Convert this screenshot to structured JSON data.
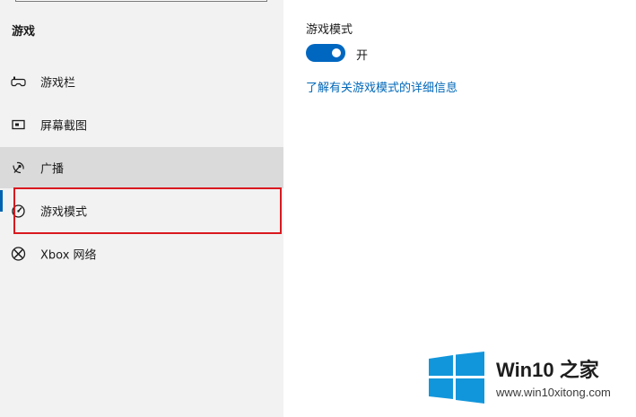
{
  "sidebar": {
    "section_title": "游戏",
    "items": [
      {
        "label": "游戏栏",
        "icon": "game-bar-icon"
      },
      {
        "label": "屏幕截图",
        "icon": "captures-icon"
      },
      {
        "label": "广播",
        "icon": "broadcast-icon"
      },
      {
        "label": "游戏模式",
        "icon": "game-mode-icon"
      },
      {
        "label": "Xbox 网络",
        "icon": "xbox-icon"
      }
    ],
    "active_index": 3,
    "hover_index": 2
  },
  "main": {
    "setting_title": "游戏模式",
    "toggle_state": "开",
    "toggle_on": true,
    "link_text": "了解有关游戏模式的详细信息"
  },
  "watermark": {
    "title": "Win10 之家",
    "url": "www.win10xitong.com"
  },
  "colors": {
    "accent": "#0067c0",
    "link": "#0067b8",
    "highlight": "#d9191f",
    "sidebar_bg": "#f2f2f2",
    "logo_blue": "#1296db"
  }
}
